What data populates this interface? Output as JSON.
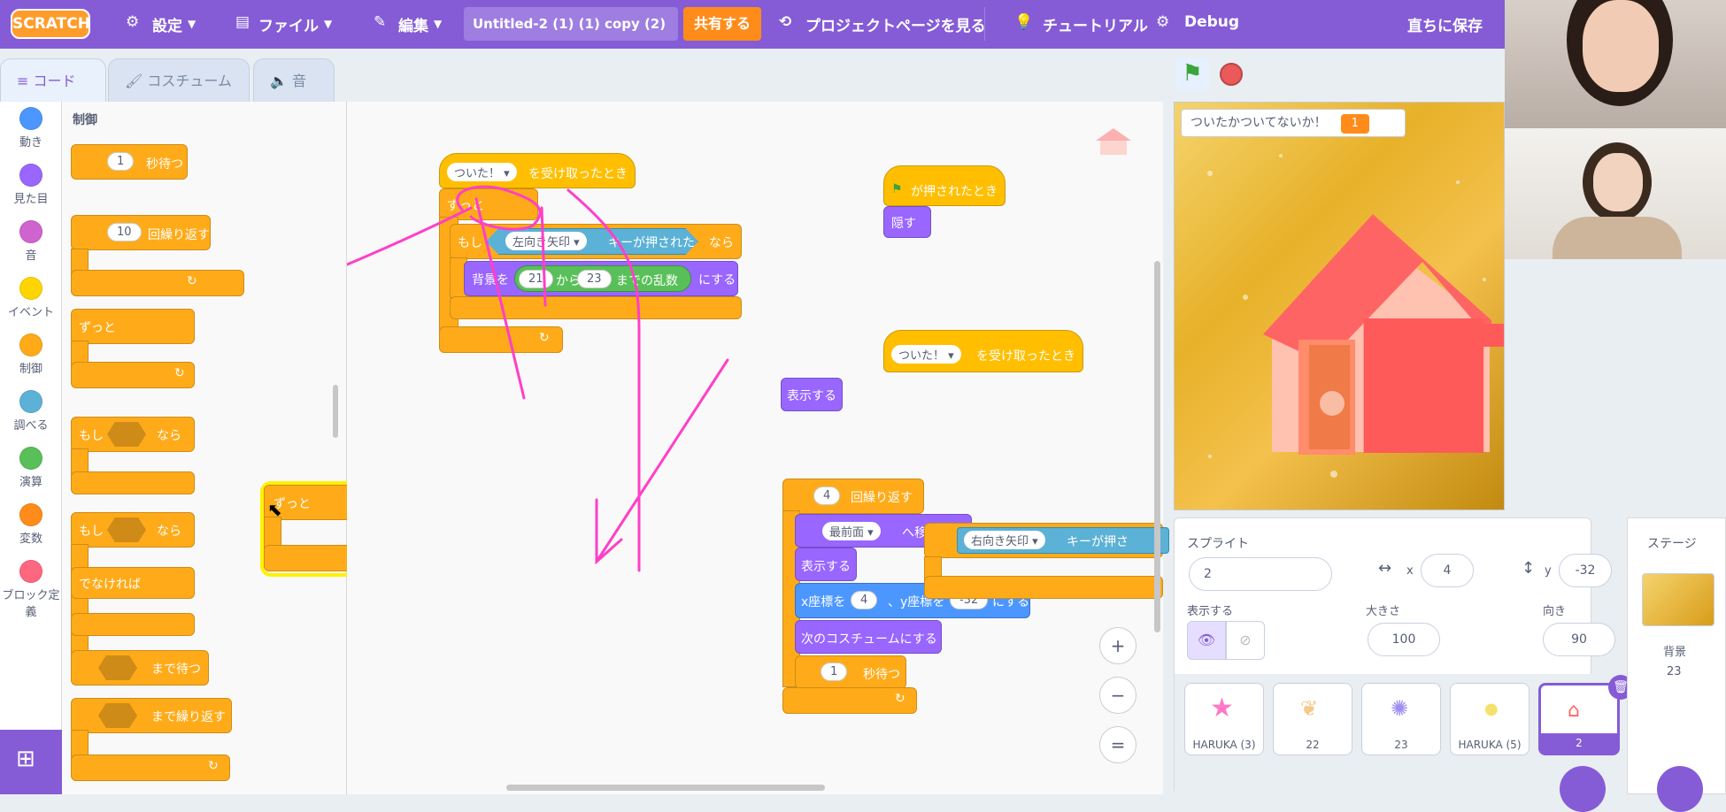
{
  "menubar": {
    "logo": "SCRATCH",
    "settings": "設定",
    "file": "ファイル",
    "edit": "編集",
    "project_title": "Untitled-2 (1) (1) copy (2)",
    "share": "共有する",
    "project_page": "プロジェクトページを見る",
    "tutorials": "チュートリアル",
    "debug": "Debug",
    "save_now": "直ちに保存"
  },
  "tabs": [
    "コード",
    "コスチューム",
    "音"
  ],
  "categories": [
    {
      "label": "動き",
      "color": "#4c97ff"
    },
    {
      "label": "見た目",
      "color": "#9966ff"
    },
    {
      "label": "音",
      "color": "#cf63cf"
    },
    {
      "label": "イベント",
      "color": "#ffd500"
    },
    {
      "label": "制御",
      "color": "#ffab19"
    },
    {
      "label": "調べる",
      "color": "#5cb1d6"
    },
    {
      "label": "演算",
      "color": "#59c059"
    },
    {
      "label": "変数",
      "color": "#ff8c1a"
    },
    {
      "label": "ブロック定義",
      "color": "#ff6680"
    }
  ],
  "palette": {
    "heading": "制御",
    "wait_value": "1",
    "wait_label": "秒待つ",
    "repeat_value": "10",
    "repeat_label": "回繰り返す",
    "forever": "ずっと",
    "if": "もし",
    "then": "なら",
    "else": "でなければ",
    "wait_until": "まで待つ",
    "repeat_until": "まで繰り返す"
  },
  "workspace": {
    "dragged_forever": "ずっと",
    "script1": {
      "msg": "ついた！",
      "receive": "を受け取ったとき",
      "forever": "ずっと",
      "if": "もし",
      "key": "左向き矢印",
      "pressed": "キーが押された",
      "then": "なら",
      "backdrop": "背景を",
      "from": "21",
      "from_label": "から",
      "to": "23",
      "random_label": "までの乱数",
      "set_label": "にする"
    },
    "script2": {
      "flag_label": "が押されたとき",
      "hide": "隠す"
    },
    "script3": {
      "msg": "ついた！",
      "receive": "を受け取ったとき"
    },
    "show_loose": "表示する",
    "script4": {
      "repeat_value": "4",
      "repeat_label": "回繰り返す",
      "layer": "最前面",
      "layer_label": "へ移動する",
      "show": "表示する",
      "x_label": "x座標を",
      "x_value": "4",
      "y_label": "、y座標を",
      "y_value": "-32",
      "set_label": "にする",
      "next_costume": "次のコスチュームにする",
      "wait_value": "1",
      "wait_label": "秒待つ"
    },
    "right_key": "右向き矢印",
    "right_pressed": "キーが押さ",
    "zoom_in": "+",
    "zoom_out": "−",
    "zoom_reset": "="
  },
  "stage": {
    "monitor_label": "ついたかついてないか！",
    "monitor_value": "1"
  },
  "sprite_info": {
    "sprite_label": "スプライト",
    "sprite_name": "2",
    "x_label": "x",
    "x_value": "4",
    "y_label": "y",
    "y_value": "-32",
    "show_label": "表示する",
    "size_label": "大きさ",
    "size_value": "100",
    "direction_label": "向き",
    "direction_value": "90"
  },
  "sprites": [
    "HARUKA (3)",
    "22",
    "23",
    "HARUKA (5)",
    "2"
  ],
  "stage_panel": {
    "title": "ステージ",
    "backdrop_label": "背景",
    "backdrop_count": "23"
  }
}
